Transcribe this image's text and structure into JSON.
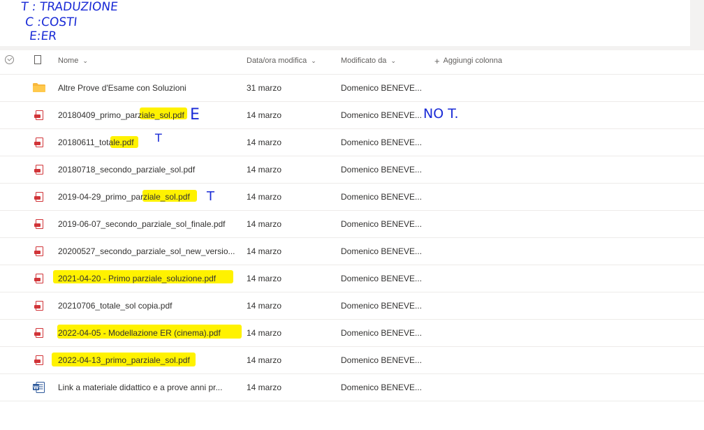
{
  "handwriting": {
    "line1": "T : TRADUZIONE",
    "line2": "C :COSTI",
    "line3": "E:ER",
    "row_e": "E",
    "row_not": "NO T.",
    "row_t1": "T",
    "row_t2": "T"
  },
  "header": {
    "name": "Nome",
    "modified": "Data/ora modifica",
    "modified_by": "Modificato da",
    "add_column": "Aggiungi colonna"
  },
  "files": [
    {
      "name": "Altre Prove d'Esame con Soluzioni",
      "type": "folder",
      "date": "31 marzo",
      "by": "Domenico BENEVE..."
    },
    {
      "name": "20180409_primo_parziale_sol.pdf",
      "type": "pdf",
      "date": "14 marzo",
      "by": "Domenico BENEVE..."
    },
    {
      "name": "20180611_totale.pdf",
      "type": "pdf",
      "date": "14 marzo",
      "by": "Domenico BENEVE..."
    },
    {
      "name": "20180718_secondo_parziale_sol.pdf",
      "type": "pdf",
      "date": "14 marzo",
      "by": "Domenico BENEVE..."
    },
    {
      "name": "2019-04-29_primo_parziale_sol.pdf",
      "type": "pdf",
      "date": "14 marzo",
      "by": "Domenico BENEVE..."
    },
    {
      "name": "2019-06-07_secondo_parziale_sol_finale.pdf",
      "type": "pdf",
      "date": "14 marzo",
      "by": "Domenico BENEVE..."
    },
    {
      "name": "20200527_secondo_parziale_sol_new_versio...",
      "type": "pdf",
      "date": "14 marzo",
      "by": "Domenico BENEVE..."
    },
    {
      "name": "2021-04-20 - Primo parziale_soluzione.pdf",
      "type": "pdf",
      "date": "14 marzo",
      "by": "Domenico BENEVE..."
    },
    {
      "name": "20210706_totale_sol copia.pdf",
      "type": "pdf",
      "date": "14 marzo",
      "by": "Domenico BENEVE..."
    },
    {
      "name": "2022-04-05 - Modellazione ER (cinema).pdf",
      "type": "pdf",
      "date": "14 marzo",
      "by": "Domenico BENEVE..."
    },
    {
      "name": "2022-04-13_primo_parziale_sol.pdf",
      "type": "pdf",
      "date": "14 marzo",
      "by": "Domenico BENEVE..."
    },
    {
      "name": "Link a materiale didattico e a prove anni pr...",
      "type": "word",
      "date": "14 marzo",
      "by": "Domenico BENEVE..."
    }
  ],
  "colors": {
    "highlight": "#fff200",
    "ink": "#1a2bd6",
    "pdf": "#d13438",
    "folder": "#f8b83d",
    "word": "#2b579a"
  }
}
